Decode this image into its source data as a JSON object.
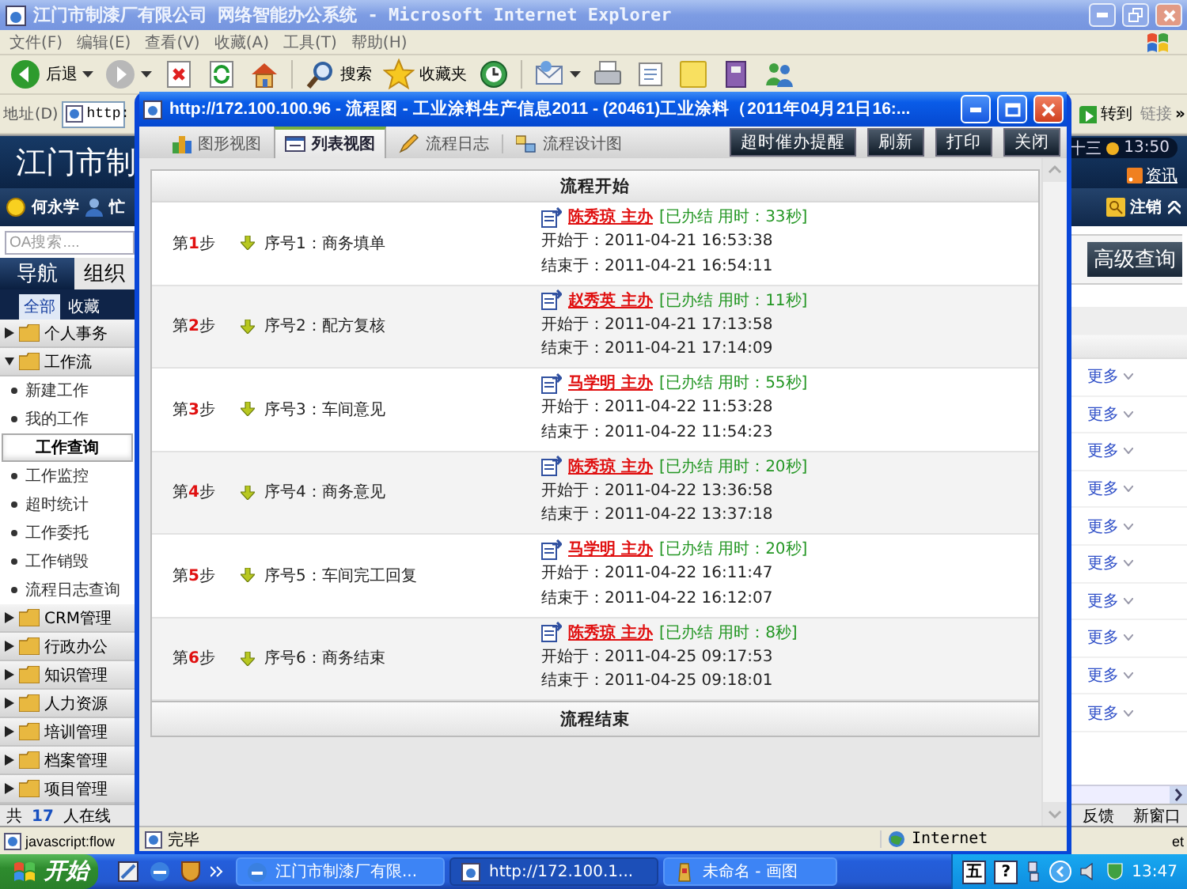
{
  "browser": {
    "title": "江门市制漆厂有限公司 网络智能办公系统 - Microsoft Internet Explorer",
    "menu": [
      "文件(F)",
      "编辑(E)",
      "查看(V)",
      "收藏(A)",
      "工具(T)",
      "帮助(H)"
    ],
    "toolbar": [
      {
        "kind": "back",
        "label": "后退"
      },
      {
        "kind": "forward"
      },
      {
        "kind": "stop"
      },
      {
        "kind": "refresh"
      },
      {
        "kind": "home"
      },
      {
        "kind": "search",
        "label": "搜索"
      },
      {
        "kind": "favorites",
        "label": "收藏夹"
      },
      {
        "kind": "history"
      },
      {
        "kind": "mail"
      },
      {
        "kind": "print"
      },
      {
        "kind": "edit"
      },
      {
        "kind": "note"
      },
      {
        "kind": "research"
      },
      {
        "kind": "messenger"
      }
    ],
    "address_label": "地址(D)",
    "address": "http:",
    "go": "转到",
    "links": "链接",
    "chevron": "»",
    "status": "javascript:flow",
    "status_right": "et"
  },
  "app": {
    "brand": "江门市制",
    "date": "十三",
    "time": "13:50",
    "news": "资讯",
    "user": "何永学",
    "user_status": "忙",
    "logout": "注销",
    "search": {
      "placeholder": "OA搜索...."
    },
    "nav_tabs": [
      {
        "label": "导航",
        "selected": true
      },
      {
        "label": "组织",
        "selected": false
      }
    ],
    "sub_tabs": [
      {
        "label": "全部",
        "selected": true
      },
      {
        "label": "收藏",
        "selected": false
      }
    ],
    "menu": [
      {
        "label": "个人事务",
        "expanded": false
      },
      {
        "label": "工作流",
        "expanded": true,
        "children": [
          {
            "label": "新建工作",
            "selected": false
          },
          {
            "label": "我的工作",
            "selected": false
          },
          {
            "label": "工作查询",
            "selected": true
          },
          {
            "label": "工作监控",
            "selected": false
          },
          {
            "label": "超时统计",
            "selected": false
          },
          {
            "label": "工作委托",
            "selected": false
          },
          {
            "label": "工作销毁",
            "selected": false
          },
          {
            "label": "流程日志查询",
            "selected": false
          }
        ]
      },
      {
        "label": "CRM管理",
        "expanded": false
      },
      {
        "label": "行政办公",
        "expanded": false
      },
      {
        "label": "知识管理",
        "expanded": false
      },
      {
        "label": "人力资源",
        "expanded": false
      },
      {
        "label": "培训管理",
        "expanded": false
      },
      {
        "label": "档案管理",
        "expanded": false
      },
      {
        "label": "项目管理",
        "expanded": false
      }
    ],
    "online": {
      "before": "共",
      "count": "17",
      "after": "人在线"
    },
    "advanced_search": "高级查询",
    "more_links": [
      "更多",
      "更多",
      "更多",
      "更多",
      "更多",
      "更多",
      "更多",
      "更多",
      "更多",
      "更多"
    ],
    "feedback": "反馈",
    "new_window": "新窗口"
  },
  "popup": {
    "title": "http://172.100.100.96 - 流程图 - 工业涂料生产信息2011 - (20461)工业涂料（2011年04月21日16:...",
    "tabs": [
      {
        "label": "图形视图",
        "selected": false
      },
      {
        "label": "列表视图",
        "selected": true
      },
      {
        "label": "流程日志",
        "selected": false
      },
      {
        "label": "流程设计图",
        "selected": false
      }
    ],
    "buttons": [
      "超时催办提醒",
      "刷新",
      "打印",
      "关闭"
    ],
    "flow_start": "流程开始",
    "steps": [
      {
        "step": {
          "before": "第",
          "number": "1",
          "after": "步"
        },
        "name": "序号1：商务填单",
        "handler": "陈秀琼 主办",
        "state": "[已办结 用时：33秒]",
        "start": "开始于：2011-04-21 16:53:38",
        "end": "结束于：2011-04-21 16:54:11"
      },
      {
        "step": {
          "before": "第",
          "number": "2",
          "after": "步"
        },
        "name": "序号2：配方复核",
        "handler": "赵秀英 主办",
        "state": "[已办结 用时：11秒]",
        "start": "开始于：2011-04-21 17:13:58",
        "end": "结束于：2011-04-21 17:14:09"
      },
      {
        "step": {
          "before": "第",
          "number": "3",
          "after": "步"
        },
        "name": "序号3：车间意见",
        "handler": "马学明 主办",
        "state": "[已办结 用时：55秒]",
        "start": "开始于：2011-04-22 11:53:28",
        "end": "结束于：2011-04-22 11:54:23"
      },
      {
        "step": {
          "before": "第",
          "number": "4",
          "after": "步"
        },
        "name": "序号4：商务意见",
        "handler": "陈秀琼 主办",
        "state": "[已办结 用时：20秒]",
        "start": "开始于：2011-04-22 13:36:58",
        "end": "结束于：2011-04-22 13:37:18"
      },
      {
        "step": {
          "before": "第",
          "number": "5",
          "after": "步"
        },
        "name": "序号5：车间完工回复",
        "handler": "马学明 主办",
        "state": "[已办结 用时：20秒]",
        "start": "开始于：2011-04-22 16:11:47",
        "end": "结束于：2011-04-22 16:12:07"
      },
      {
        "step": {
          "before": "第",
          "number": "6",
          "after": "步"
        },
        "name": "序号6：商务结束",
        "handler": "陈秀琼 主办",
        "state": "[已办结 用时：8秒]",
        "start": "开始于：2011-04-25 09:17:53",
        "end": "结束于：2011-04-25 09:18:01"
      }
    ],
    "flow_end": "流程结束",
    "status": "完毕",
    "zone": "Internet"
  },
  "taskbar": {
    "start": "开始",
    "tasks": [
      {
        "label": "江门市制漆厂有限...",
        "selected": false
      },
      {
        "label": "http://172.100.1...",
        "selected": true
      },
      {
        "label": "未命名 - 画图",
        "selected": false
      }
    ],
    "tray": [
      "五",
      "?"
    ],
    "time": "13:47"
  }
}
